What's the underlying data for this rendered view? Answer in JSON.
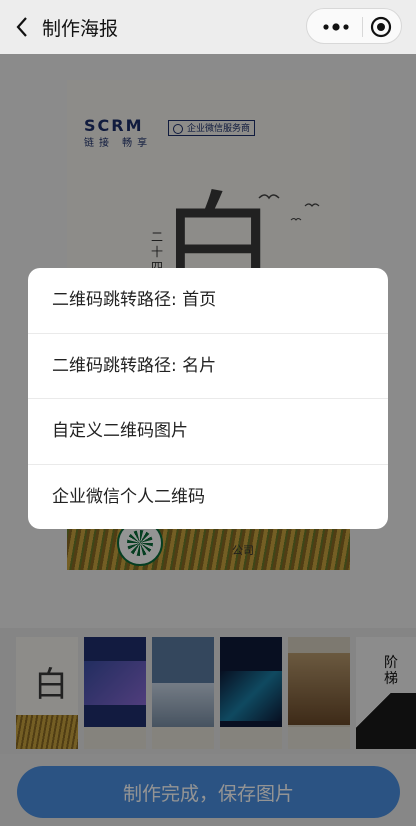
{
  "nav": {
    "title": "制作海报",
    "back_icon": "chevron-left-icon",
    "more_icon": "more-dots-icon",
    "close_icon": "target-close-icon"
  },
  "poster": {
    "brand": "SCRM",
    "brand_sub": "链接 畅享",
    "tag": "企业微信服务商",
    "big_char": "白",
    "vertical_text": "二十四节",
    "org_text": "公司"
  },
  "thumbnails": [
    {
      "name": "thumb-bailu",
      "colors": [
        "#f3f1ec",
        "#c9a23e"
      ]
    },
    {
      "name": "thumb-blue-night",
      "colors": [
        "#20306e",
        "#e6e2d8"
      ]
    },
    {
      "name": "thumb-blue-town",
      "colors": [
        "#5a7aa0",
        "#e6e2d8"
      ]
    },
    {
      "name": "thumb-cyber",
      "colors": [
        "#0e1b3a",
        "#e6e2d8"
      ]
    },
    {
      "name": "thumb-brown",
      "colors": [
        "#6b4a2a",
        "#e6e2d8"
      ]
    },
    {
      "name": "thumb-stairs",
      "colors": [
        "#f2f2f2",
        "#1a1a1a"
      ]
    }
  ],
  "thumb_stairs_text": "阶梯",
  "sheet": {
    "options": [
      "二维码跳转路径: 首页",
      "二维码跳转路径: 名片",
      "自定义二维码图片",
      "企业微信个人二维码"
    ]
  },
  "save_button": "制作完成，保存图片",
  "colors": {
    "accent": "#4a90e2",
    "mask": "rgba(0,0,0,0.42)"
  }
}
